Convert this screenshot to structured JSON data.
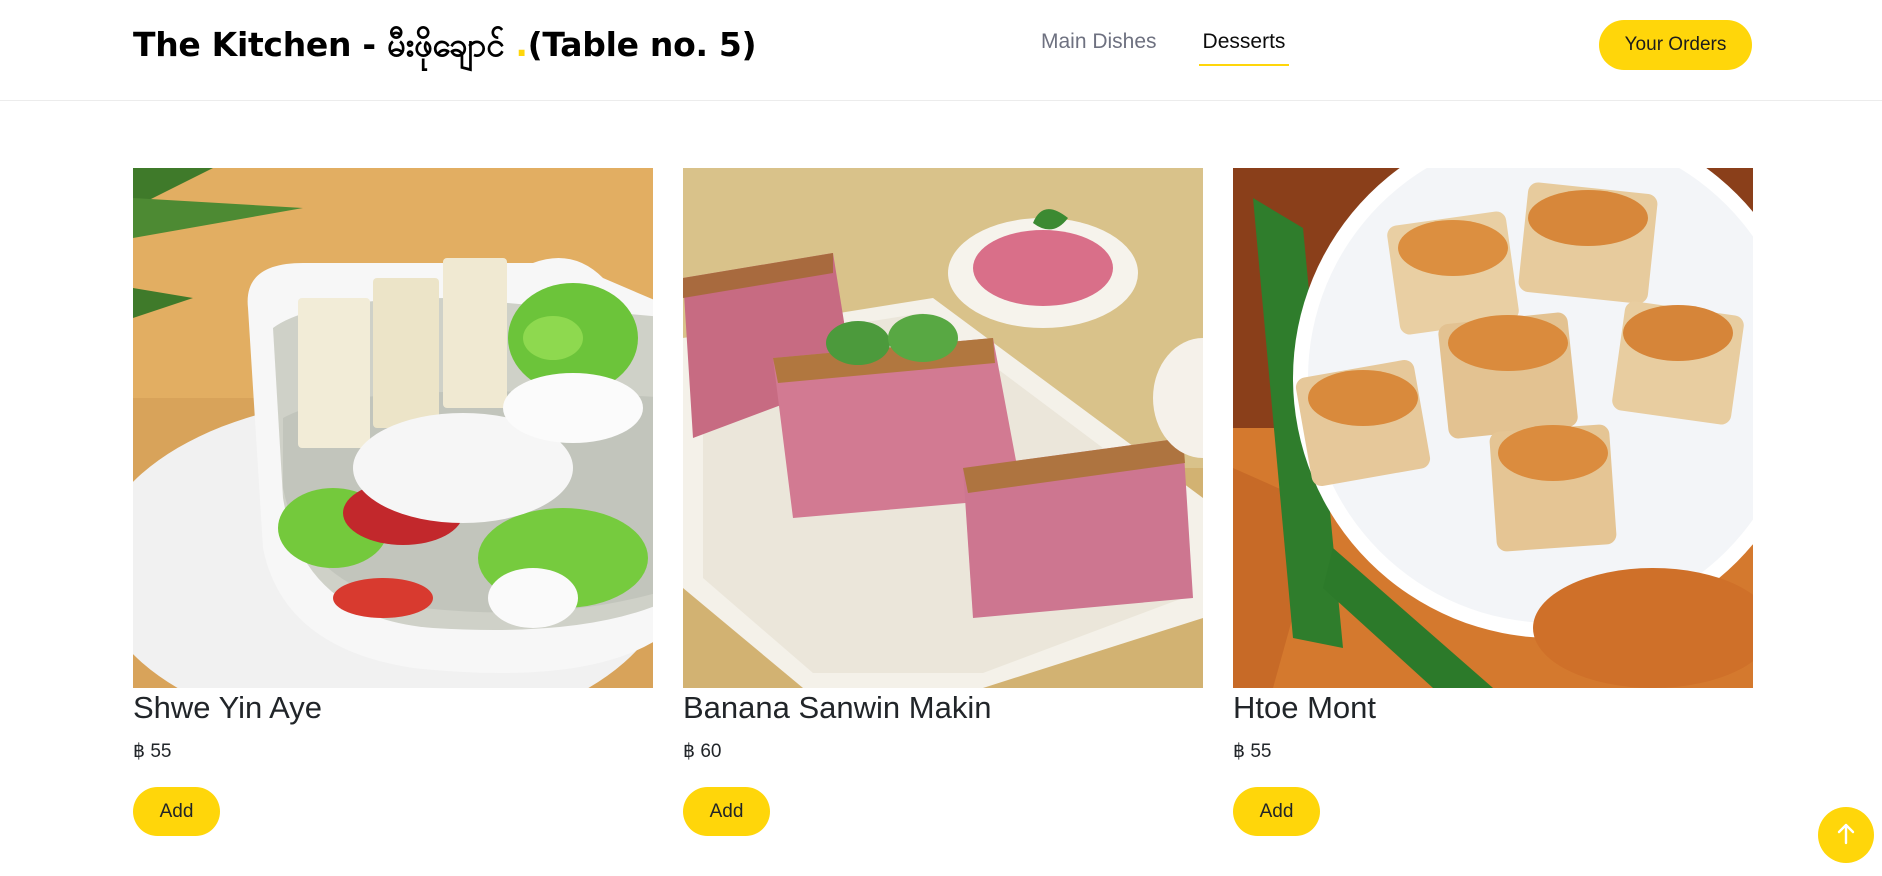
{
  "header": {
    "brand_prefix": "The Kitchen - မီးဖိုချောင်",
    "brand_dot": ".",
    "brand_suffix": "(Table no. 5)",
    "nav": [
      {
        "label": "Main Dishes",
        "active": false
      },
      {
        "label": "Desserts",
        "active": true
      }
    ],
    "orders_label": "Your Orders"
  },
  "menu": {
    "items": [
      {
        "name": "Shwe Yin Aye",
        "price": "฿ 55",
        "add_label": "Add",
        "image": "shwe-yin-aye-photo"
      },
      {
        "name": "Banana Sanwin Makin",
        "price": "฿ 60",
        "add_label": "Add",
        "image": "banana-sanwin-makin-photo"
      },
      {
        "name": "Htoe Mont",
        "price": "฿ 55",
        "add_label": "Add",
        "image": "htoe-mont-photo"
      }
    ]
  },
  "scroll_top": {
    "icon": "arrow-up-icon"
  },
  "colors": {
    "accent": "#ffd60a",
    "nav_inactive": "#6e7180",
    "text": "#212529"
  }
}
